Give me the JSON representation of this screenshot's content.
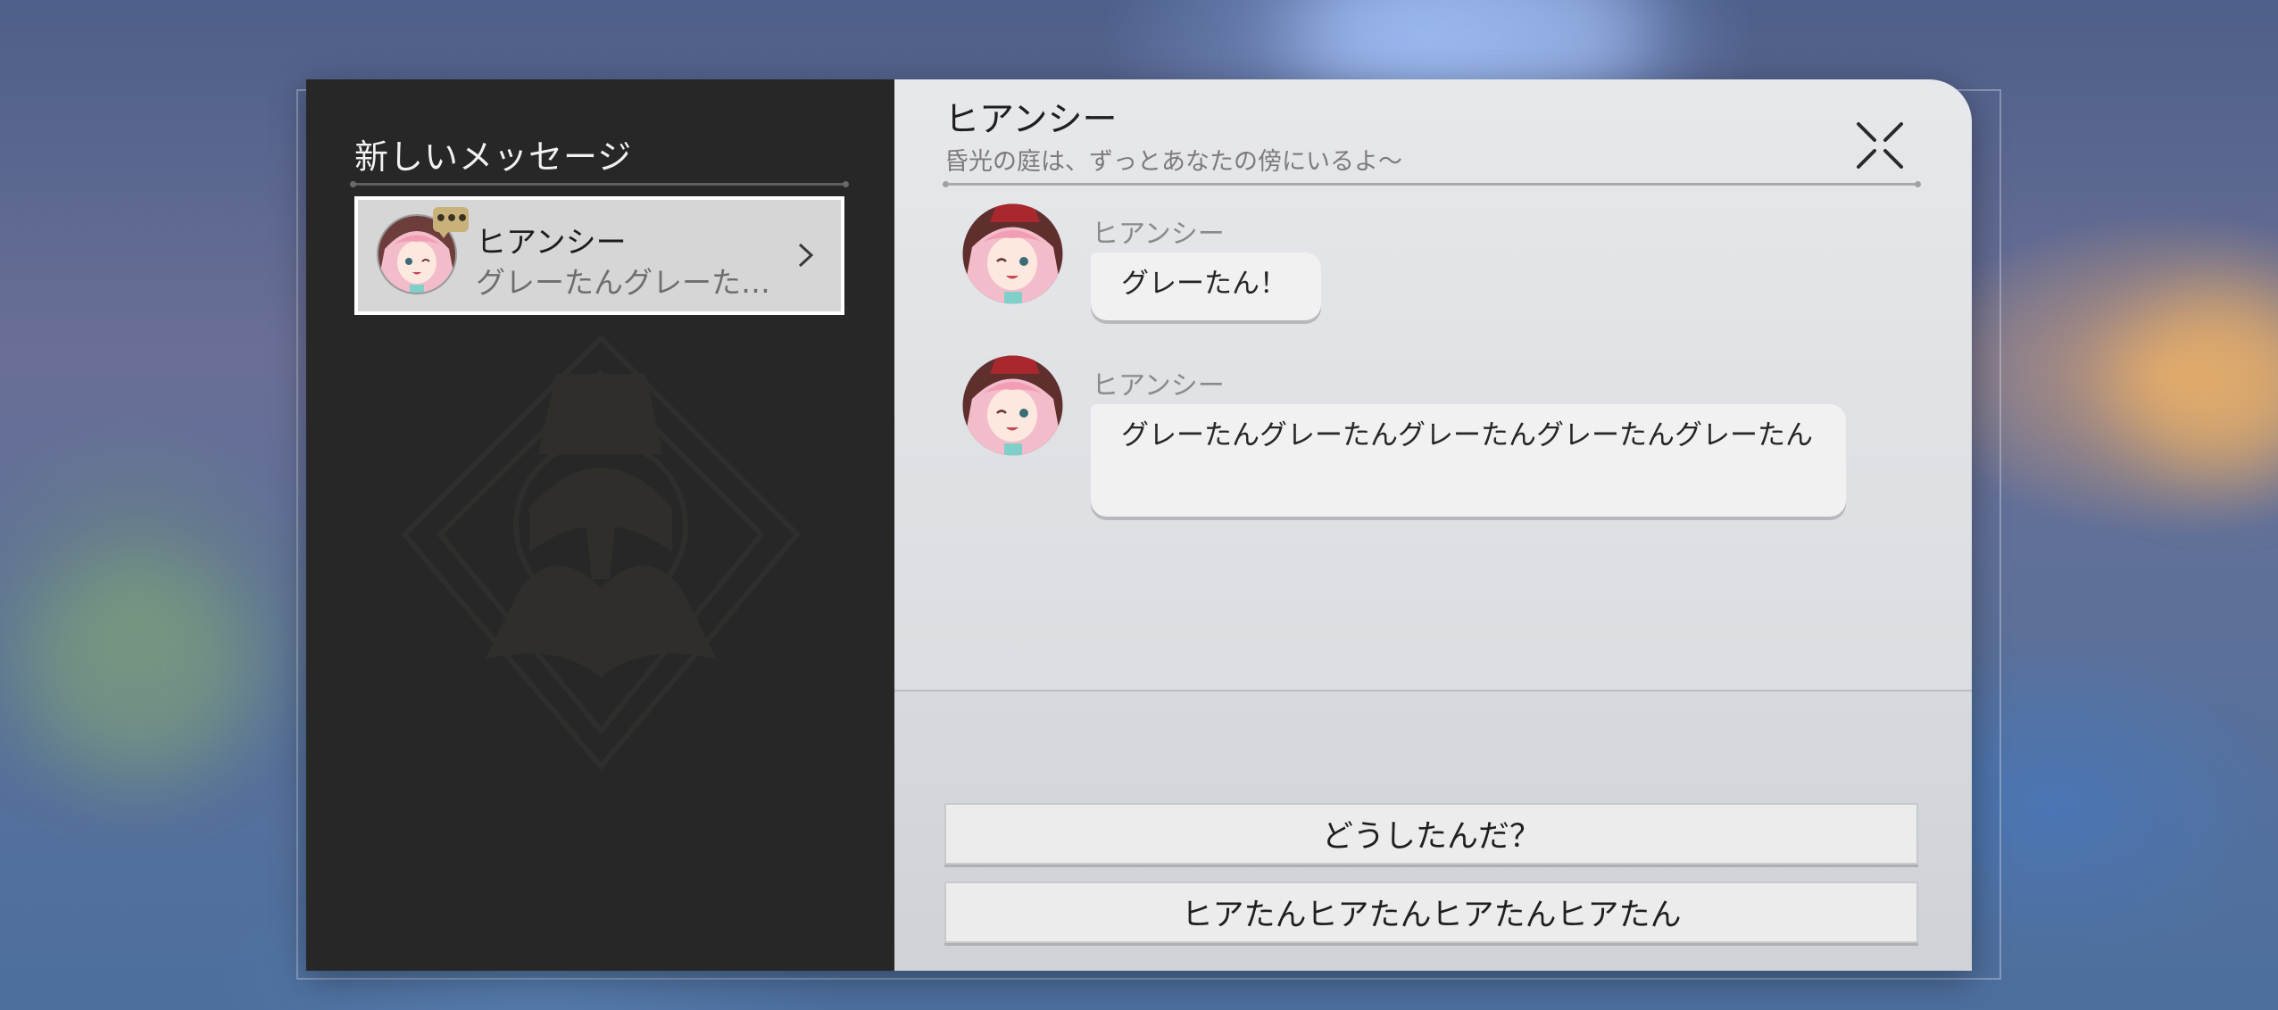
{
  "left_panel": {
    "title": "新しいメッセージ",
    "contacts": [
      {
        "name": "ヒアンシー",
        "preview": "グレーたんグレーた…",
        "typing_indicator": "•••"
      }
    ]
  },
  "chat": {
    "contact_name": "ヒアンシー",
    "status": "昏光の庭は、ずっとあなたの傍にいるよ～",
    "messages": [
      {
        "sender": "ヒアンシー",
        "text": "グレーたん！"
      },
      {
        "sender": "ヒアンシー",
        "text": "グレーたんグレーたんグレーたんグレーたんグレーたん"
      }
    ],
    "replies": [
      {
        "label": "どうしたんだ？"
      },
      {
        "label": "ヒアたんヒアたんヒアたんヒアたん"
      }
    ]
  },
  "colors": {
    "left_panel_bg": "#272727",
    "right_panel_bg": "#e3e4e8",
    "badge_gold": "#c9b27a",
    "avatar_pink": "#f2b8c6",
    "avatar_hat_red": "#a8282e"
  },
  "icons": [
    "typing-bubble-icon",
    "chevron-right-icon",
    "close-icon",
    "emblem-logo"
  ]
}
